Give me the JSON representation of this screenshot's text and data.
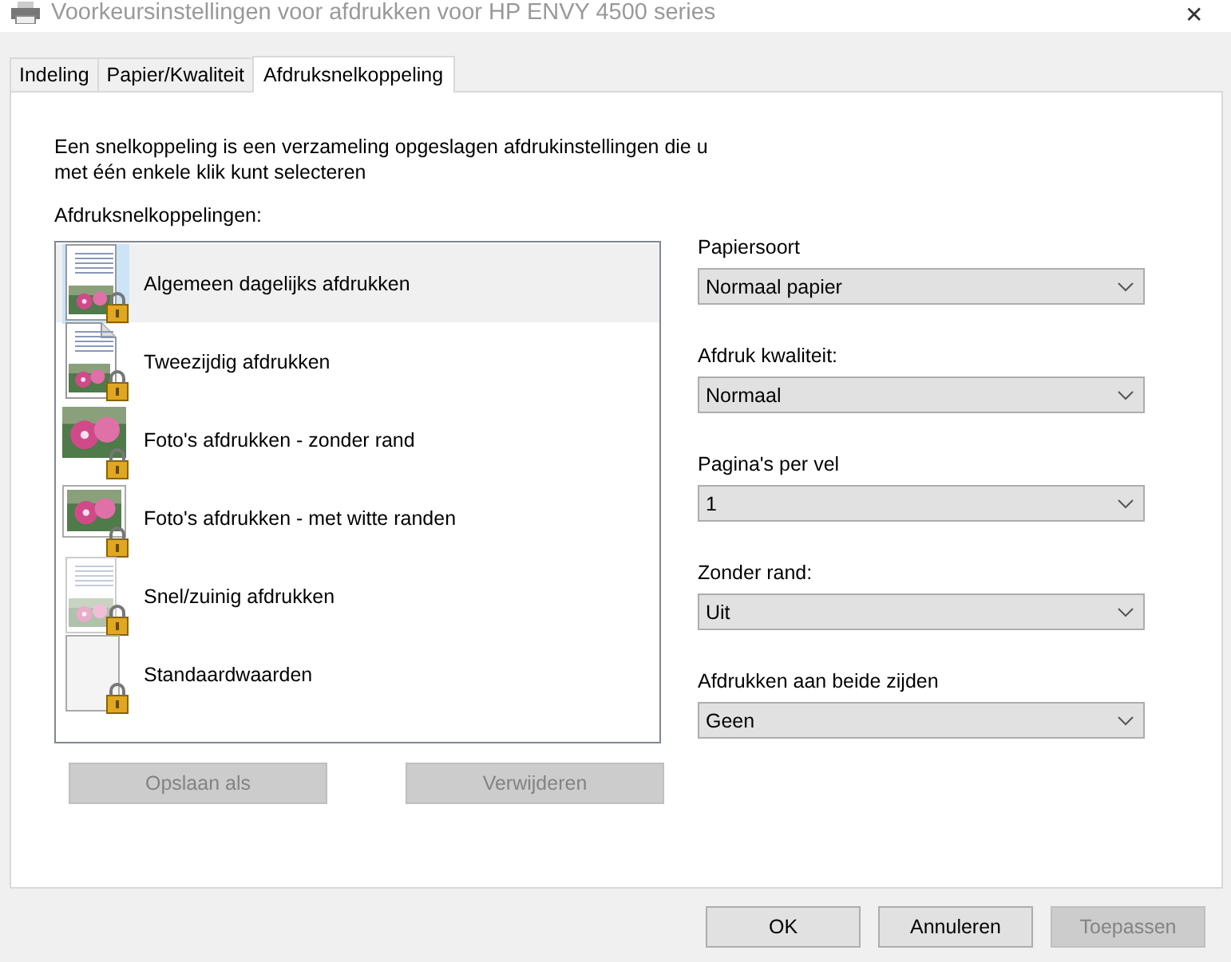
{
  "window": {
    "title": "Voorkeursinstellingen voor afdrukken voor HP ENVY 4500 series",
    "close": "✕"
  },
  "tabs": [
    {
      "label": "Indeling",
      "selected": false
    },
    {
      "label": "Papier/Kwaliteit",
      "selected": false
    },
    {
      "label": "Afdruksnelkoppeling",
      "selected": true
    }
  ],
  "description": "Een snelkoppeling is een verzameling opgeslagen afdrukinstellingen die u met één enkele klik kunt selecteren",
  "shortcuts": {
    "label": "Afdruksnelkoppelingen:",
    "items": [
      {
        "label": "Algemeen dagelijks afdrukken",
        "kind": "document",
        "selected": true
      },
      {
        "label": "Tweezijdig afdrukken",
        "kind": "duplex",
        "selected": false
      },
      {
        "label": "Foto's afdrukken - zonder rand",
        "kind": "photo",
        "selected": false
      },
      {
        "label": "Foto's afdrukken - met witte randen",
        "kind": "framed-photo",
        "selected": false
      },
      {
        "label": "Snel/zuinig afdrukken",
        "kind": "faded-document",
        "selected": false
      },
      {
        "label": "Standaardwaarden",
        "kind": "blank",
        "selected": false
      }
    ]
  },
  "list_buttons": [
    {
      "label": "Opslaan als",
      "disabled": true
    },
    {
      "label": "Verwijderen",
      "disabled": true
    }
  ],
  "settings": [
    {
      "label": "Papiersoort",
      "value": "Normaal papier"
    },
    {
      "label": "Afdruk kwaliteit:",
      "value": "Normaal"
    },
    {
      "label": "Pagina's per vel",
      "value": "1"
    },
    {
      "label": "Zonder rand:",
      "value": "Uit"
    },
    {
      "label": "Afdrukken aan beide zijden",
      "value": "Geen"
    }
  ],
  "dialog_buttons": [
    {
      "label": "OK",
      "disabled": false
    },
    {
      "label": "Annuleren",
      "disabled": false
    },
    {
      "label": "Toepassen",
      "disabled": true
    }
  ]
}
